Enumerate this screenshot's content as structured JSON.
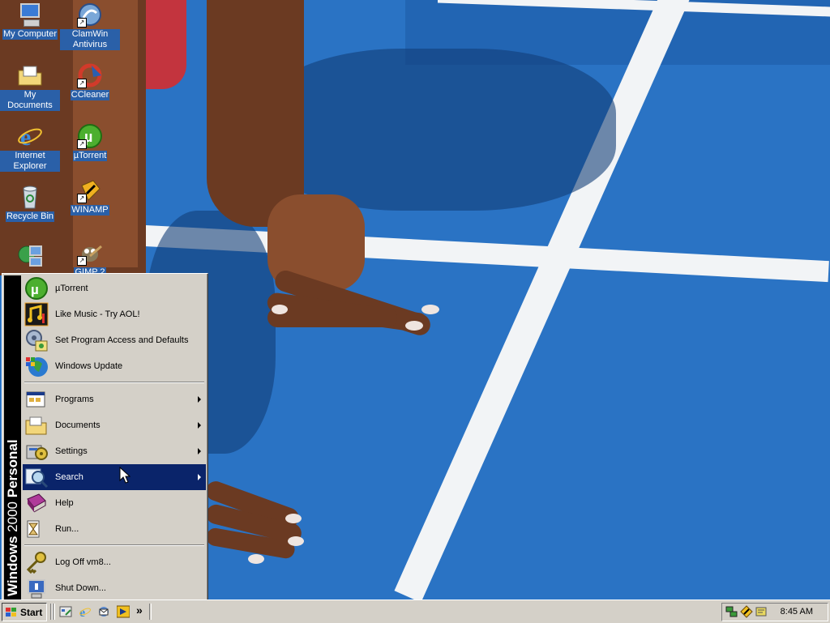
{
  "desktop": {
    "icons": [
      {
        "label": "My Computer",
        "icon": "my-computer-icon"
      },
      {
        "label": "ClamWin Antivirus",
        "icon": "clamwin-icon"
      },
      {
        "label": "My Documents",
        "icon": "my-documents-icon"
      },
      {
        "label": "CCleaner",
        "icon": "ccleaner-icon"
      },
      {
        "label": "Internet Explorer",
        "icon": "internet-explorer-icon"
      },
      {
        "label": "µTorrent",
        "icon": "utorrent-icon"
      },
      {
        "label": "Recycle Bin",
        "icon": "recycle-bin-icon"
      },
      {
        "label": "WINAMP",
        "icon": "winamp-icon"
      },
      {
        "label": "",
        "icon": "network-icon"
      },
      {
        "label": "GIMP 2",
        "icon": "gimp-icon"
      }
    ]
  },
  "start_menu": {
    "brand": {
      "product": "Windows",
      "version": "2000",
      "edition": "Personal"
    },
    "pinned": [
      {
        "label": "µTorrent",
        "icon": "utorrent-icon"
      },
      {
        "label": "Like Music - Try AOL!",
        "icon": "music-icon"
      },
      {
        "label": "Set Program Access and Defaults",
        "icon": "program-access-icon"
      },
      {
        "label": "Windows Update",
        "icon": "windows-update-icon"
      }
    ],
    "main": [
      {
        "label": "Programs",
        "icon": "programs-icon",
        "submenu": true
      },
      {
        "label": "Documents",
        "icon": "documents-folder-icon",
        "submenu": true
      },
      {
        "label": "Settings",
        "icon": "settings-icon",
        "submenu": true
      },
      {
        "label": "Search",
        "icon": "search-icon",
        "submenu": true,
        "active": true
      },
      {
        "label": "Help",
        "icon": "help-book-icon",
        "submenu": false
      },
      {
        "label": "Run...",
        "icon": "run-icon",
        "submenu": false
      }
    ],
    "session": [
      {
        "label": "Log Off vm8...",
        "icon": "log-off-key-icon"
      },
      {
        "label": "Shut Down...",
        "icon": "shut-down-icon"
      }
    ]
  },
  "taskbar": {
    "start_label": "Start",
    "quick_launch": [
      "show-desktop-icon",
      "internet-explorer-icon",
      "outlook-express-icon",
      "winamp-icon"
    ],
    "overflow": "»",
    "tray_icons": [
      "network-tray-icon",
      "winamp-tray-icon",
      "notification-tray-icon"
    ],
    "clock": "8:45 AM"
  },
  "colors": {
    "desktop_bg": "#2a73c4",
    "menu_bg": "#d4d0c8",
    "highlight": "#0a246a",
    "brand_bar": "#000000"
  }
}
